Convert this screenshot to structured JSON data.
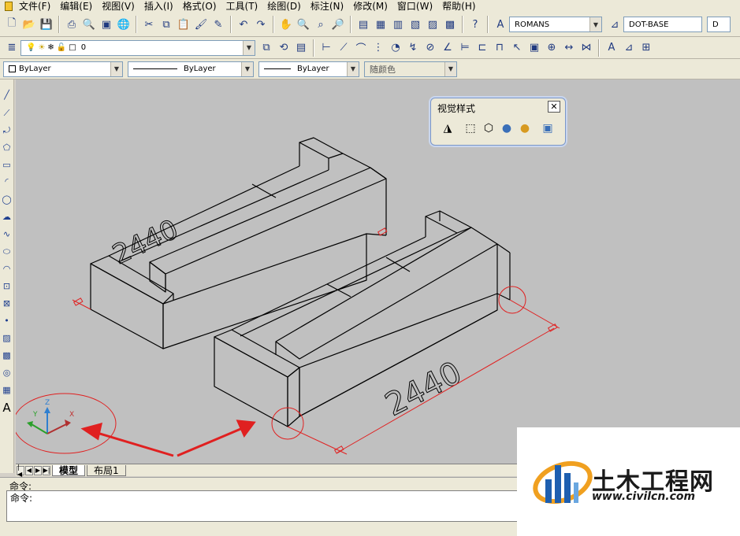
{
  "menu": [
    "文件(F)",
    "编辑(E)",
    "视图(V)",
    "插入(I)",
    "格式(O)",
    "工具(T)",
    "绘图(D)",
    "标注(N)",
    "修改(M)",
    "窗口(W)",
    "帮助(H)"
  ],
  "toolbar1": {
    "text_style": "ROMANS",
    "dim_style": "DOT-BASE",
    "third_combo": "D"
  },
  "toolbar2": {
    "layer": "0"
  },
  "toolbar3": {
    "color": "ByLayer",
    "linetype": "ByLayer",
    "lineweight": "ByLayer",
    "plot_style": "随颜色"
  },
  "visual_styles_panel": {
    "title": "视觉样式",
    "close": "✕"
  },
  "drawing": {
    "dimension_text_front": "2440",
    "dimension_text_back": "2440",
    "ucs_labels": {
      "x": "X",
      "y": "Y",
      "z": "Z"
    },
    "annotation_color": "#e02020"
  },
  "tabs": {
    "model": "模型",
    "layout1": "布局1"
  },
  "command": {
    "line1": "命令:",
    "line2": "命令:"
  },
  "watermark": {
    "title": "土木工程网",
    "url": "www.civilcn.com"
  }
}
